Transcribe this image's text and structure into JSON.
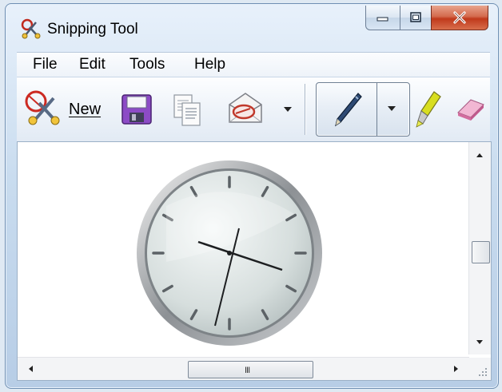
{
  "window": {
    "title": "Snipping Tool",
    "icon": "scissors-icon"
  },
  "caption_buttons": {
    "minimize": "minimize-icon",
    "maximize": "maximize-icon",
    "close": "close-icon"
  },
  "menu": {
    "items": [
      {
        "label": "File"
      },
      {
        "label": "Edit"
      },
      {
        "label": "Tools"
      },
      {
        "label": "Help"
      }
    ]
  },
  "toolbar": {
    "new_label_first": "N",
    "new_label_rest": "ew",
    "icons": [
      "scissors-icon",
      "save-icon",
      "copy-icon",
      "send-snip-icon",
      "dropdown-icon",
      "pen-icon",
      "pen-dropdown-icon",
      "highlighter-icon",
      "eraser-icon"
    ]
  },
  "content": {
    "image": "analog-clock-icon",
    "hscroll_grip": "III"
  },
  "colors": {
    "accent": "#6f8fb3",
    "close_button": "#c0391b",
    "save_disk": "#8c4bc6",
    "eraser": "#e58db8",
    "highlighter": "#d8de20"
  }
}
